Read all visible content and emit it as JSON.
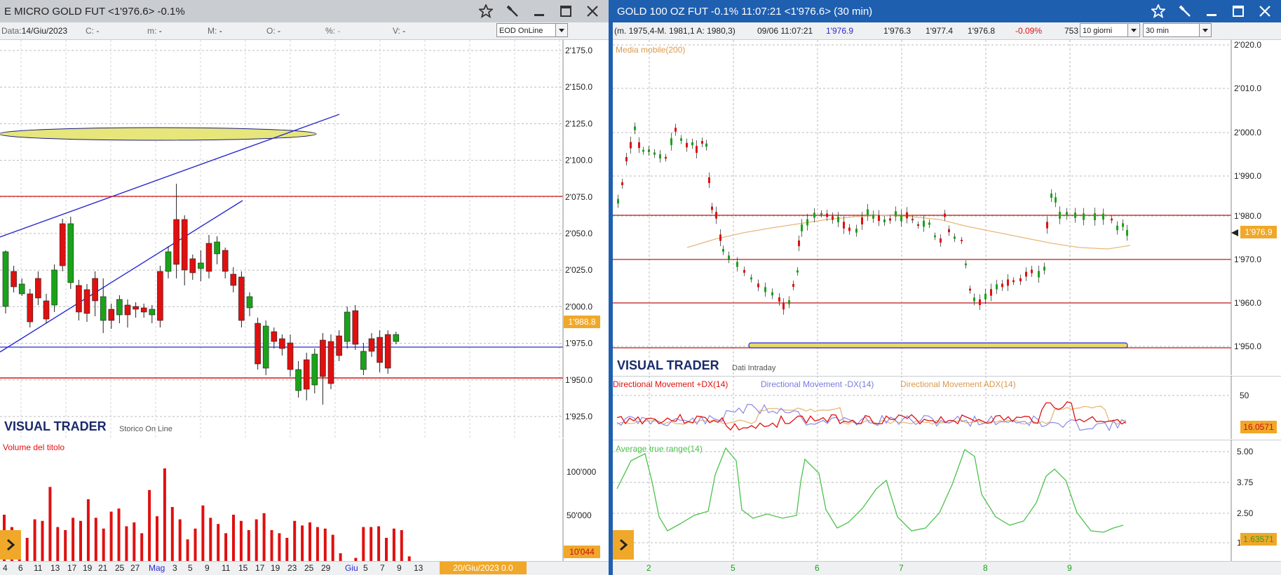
{
  "left_window": {
    "title": "E MICRO GOLD FUT <1'976.6> -0.1%",
    "info": {
      "data_label": "Data:",
      "data_value": "14/Giu/2023",
      "c_label": "C:",
      "c_value": "-",
      "m_label": "m:",
      "m_value": "-",
      "M_label": "M:",
      "M_value": "-",
      "o_label": "O:",
      "o_value": "-",
      "pct_label": "%:",
      "pct_value": "-",
      "v_label": "V:",
      "v_value": "-"
    },
    "mode_select": "EOD OnLine",
    "watermark": "VISUAL TRADER",
    "watermark_sub": "Storico On Line",
    "volume_title": "Volume del titolo",
    "price_ticks": [
      "2'175.0",
      "2'150.0",
      "2'125.0",
      "2'100.0",
      "2'075.0",
      "2'050.0",
      "2'025.0",
      "2'000.0",
      "1'975.0",
      "1'950.0",
      "1'925.0"
    ],
    "price_badge": "1'988.8",
    "volume_ticks": [
      "100'000",
      "50'000"
    ],
    "volume_badge": "10'044",
    "date_ticks": [
      "4",
      "6",
      "11",
      "13",
      "17",
      "19",
      "21",
      "25",
      "27",
      "Mag",
      "3",
      "5",
      "9",
      "11",
      "15",
      "17",
      "19",
      "23",
      "25",
      "29",
      "Giu",
      "5",
      "7",
      "9",
      "13"
    ],
    "date_cursor": "20/Giu/2023 0.0",
    "colors": {
      "bull": "#1aa31a",
      "bear": "#e01010",
      "trend": "#2a2ad0",
      "level": "#d01818",
      "ellipse": "#e6e67a",
      "badge": "#f0a82a"
    }
  },
  "right_window": {
    "title": "GOLD 100 OZ FUT -0.1% 11:07:21  <1'976.6> (30 min)",
    "info": {
      "range": "(m. 1975,4-M. 1981,1 A: 1980,3)",
      "datetime": "09/06 11:07:21",
      "last": "1'976.9",
      "open": "1'976.3",
      "high": "1'977.4",
      "low": "1'976.8",
      "change": "-0.09%",
      "volume": "753"
    },
    "period_select": "10 giorni",
    "interval_select": "30 min",
    "ma_label": "Media mobile(200)",
    "watermark": "VISUAL TRADER",
    "watermark_sub": "Dati Intraday",
    "price_ticks": [
      "2'020.0",
      "2'010.0",
      "2'000.0",
      "1'990.0",
      "1'980.0",
      "1'970.0",
      "1'960.0",
      "1'950.0"
    ],
    "price_badge": "1'976.9",
    "dm_plus_label": "Directional Movement +DX(14)",
    "dm_minus_label": "Directional Movement -DX(14)",
    "adx_label": "Directional Movement ADX(14)",
    "dm_tick": "50",
    "dm_badge": "16.0571",
    "atr_label": "Average true range(14)",
    "atr_ticks": [
      "5.00",
      "3.75",
      "2.50",
      "1.25"
    ],
    "atr_badge": "1.63571",
    "date_ticks": [
      "2",
      "5",
      "6",
      "7",
      "8",
      "9"
    ],
    "colors": {
      "ma": "#e8b87a",
      "dm_plus": "#e01010",
      "dm_minus": "#8a8ae8",
      "adx": "#e8b87a",
      "atr": "#4cc24c",
      "level": "#c01818",
      "badge": "#f0a82a"
    }
  }
}
